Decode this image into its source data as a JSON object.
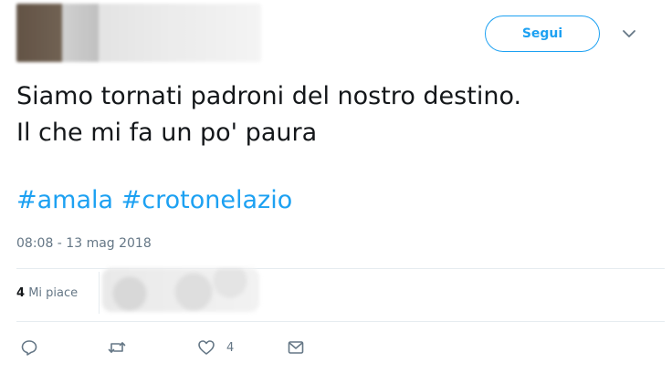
{
  "header": {
    "follow_label": "Segui",
    "menu_icon": "chevron-down-icon"
  },
  "tweet": {
    "lines": [
      "Siamo tornati padroni del nostro destino.",
      "Il che mi fa un po' paura"
    ],
    "hashtags": [
      "#amala",
      "#crotonelazio"
    ],
    "timestamp": "08:08 - 13 mag 2018"
  },
  "stats": {
    "likes_count": "4",
    "likes_label": "Mi piace"
  },
  "actions": {
    "reply_icon": "reply-icon",
    "retweet_icon": "retweet-icon",
    "like_icon": "heart-icon",
    "like_count": "4",
    "dm_icon": "envelope-icon"
  },
  "colors": {
    "accent": "#1da1f2",
    "text": "#14171a",
    "muted": "#657786",
    "divider": "#e6ecf0"
  }
}
